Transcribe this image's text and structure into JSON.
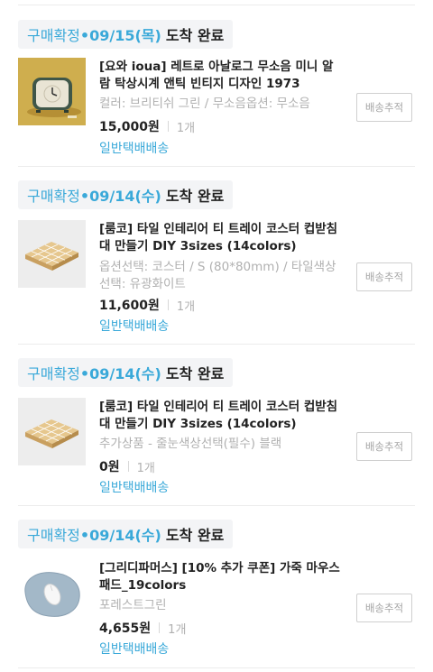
{
  "orders": [
    {
      "status_prefix": "구매확정",
      "status_date": "•09/15(목)",
      "status_text": "도착 완료",
      "title": "[요와 ioua] 레트로 아날로그 무소음 미니 알람 탁상시계 앤틱 빈티지 디자인 1973",
      "option": "컬러: 브리티쉬 그린 / 무소음옵션: 무소음",
      "price": "15,000원",
      "qty": "1개",
      "shipping": "일반택배배송",
      "track_label": "배송추적",
      "image_icon": "alarm-clock-icon"
    },
    {
      "status_prefix": "구매확정",
      "status_date": "•09/14(수)",
      "status_text": "도착 완료",
      "title": "[룸코] 타일 인테리어 티 트레이 코스터 컵받침대 만들기 DIY 3sizes (14colors)",
      "option": "옵션선택: 코스터 / S (80*80mm) / 타일색상선택: 유광화이트",
      "price": "11,600원",
      "qty": "1개",
      "shipping": "일반택배배송",
      "track_label": "배송추적",
      "image_icon": "tile-tray-icon"
    },
    {
      "status_prefix": "구매확정",
      "status_date": "•09/14(수)",
      "status_text": "도착 완료",
      "title": "[룸코] 타일 인테리어 티 트레이 코스터 컵받침대 만들기 DIY 3sizes (14colors)",
      "option": "추가상품 - 줄눈색상선택(필수) 블랙",
      "price": "0원",
      "qty": "1개",
      "shipping": "일반택배배송",
      "track_label": "배송추적",
      "image_icon": "tile-tray-icon"
    },
    {
      "status_prefix": "구매확정",
      "status_date": "•09/14(수)",
      "status_text": "도착 완료",
      "title": "[그리디파머스] [10% 추가 쿠폰] 가죽 마우스패드_19colors",
      "option": "포레스트그린",
      "price": "4,655원",
      "qty": "1개",
      "shipping": "일반택배배송",
      "track_label": "배송추적",
      "image_icon": "mouse-pad-icon"
    }
  ],
  "colors": {
    "accent": "#3aa9d9",
    "status_bg": "#f3f4f6",
    "muted": "#b0b0b0"
  }
}
